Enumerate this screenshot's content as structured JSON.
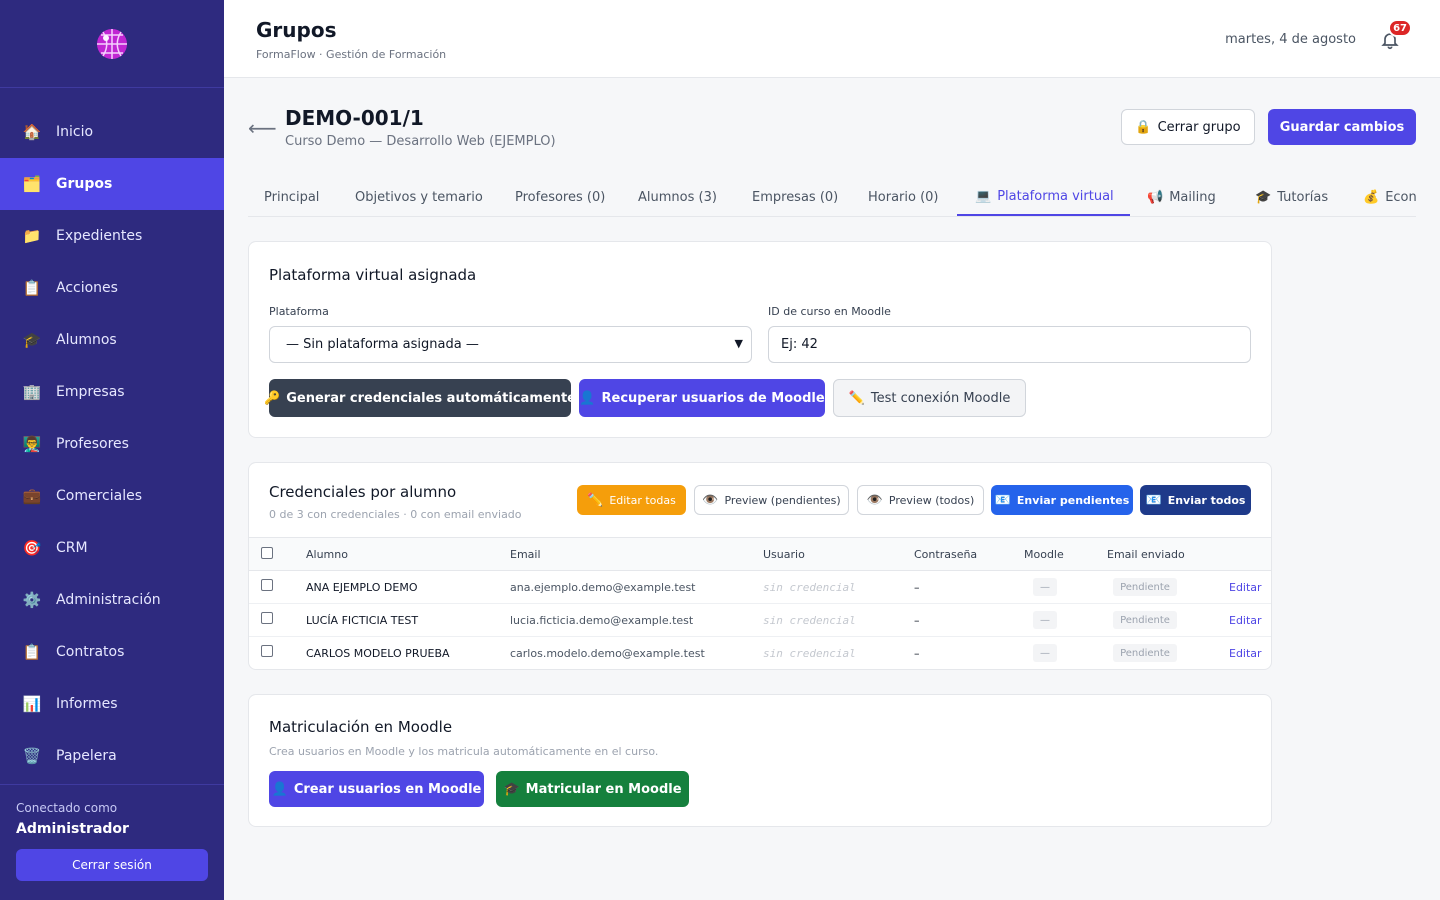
{
  "sidebar": {
    "items": [
      {
        "label": "Inicio",
        "icon": "🏠"
      },
      {
        "label": "Grupos",
        "icon": "🗂️"
      },
      {
        "label": "Expedientes",
        "icon": "📁"
      },
      {
        "label": "Acciones",
        "icon": "📋"
      },
      {
        "label": "Alumnos",
        "icon": "🎓"
      },
      {
        "label": "Empresas",
        "icon": "🏢"
      },
      {
        "label": "Profesores",
        "icon": "👨‍🏫"
      },
      {
        "label": "Comerciales",
        "icon": "💼"
      },
      {
        "label": "CRM",
        "icon": "🎯"
      },
      {
        "label": "Administración",
        "icon": "⚙️"
      },
      {
        "label": "Contratos",
        "icon": "📋"
      },
      {
        "label": "Informes",
        "icon": "📊"
      },
      {
        "label": "Papelera",
        "icon": "🗑️"
      }
    ],
    "connected_label": "Conectado como",
    "user": "Administrador",
    "logout": "Cerrar sesión"
  },
  "header": {
    "title": "Grupos",
    "breadcrumb": "FormaFlow · Gestión de Formación",
    "date": "martes, 4 de agosto",
    "notifications": "67"
  },
  "group": {
    "code": "DEMO-001/1",
    "course": "Curso Demo — Desarrollo Web (EJEMPLO)",
    "close_label": "Cerrar grupo",
    "close_icon": "🔒",
    "save_label": "Guardar cambios"
  },
  "tabs": [
    {
      "label": "Principal",
      "icon": ""
    },
    {
      "label": "Objetivos y temario",
      "icon": ""
    },
    {
      "label": "Profesores (0)",
      "icon": ""
    },
    {
      "label": "Alumnos (3)",
      "icon": ""
    },
    {
      "label": "Empresas (0)",
      "icon": ""
    },
    {
      "label": "Horario (0)",
      "icon": ""
    },
    {
      "label": "Plataforma virtual",
      "icon": "💻"
    },
    {
      "label": "Mailing",
      "icon": "📢"
    },
    {
      "label": "Tutorías",
      "icon": "🎓"
    },
    {
      "label": "Econ",
      "icon": "💰"
    }
  ],
  "platform": {
    "title": "Plataforma virtual asignada",
    "platform_label": "Plataforma",
    "platform_value": "— Sin plataforma asignada —",
    "moodle_id_label": "ID de curso en Moodle",
    "moodle_id_value": "Ej: 42",
    "btn_generate": "Generar credenciales automáticamente",
    "btn_generate_icon": "🔑",
    "btn_recover": "Recuperar usuarios de Moodle",
    "btn_recover_icon": "👤",
    "btn_test": "Test conexión Moodle",
    "btn_test_icon": "✏️"
  },
  "credentials": {
    "title": "Credenciales por alumno",
    "summary": "0 de 3 con credenciales · 0 con email enviado",
    "btn_edit_all": "Editar todas",
    "btn_edit_all_icon": "✏️",
    "btn_preview_pending": "Preview (pendientes)",
    "btn_preview_all": "Preview (todos)",
    "preview_icon": "👁️",
    "btn_send_pending": "Enviar pendientes",
    "btn_send_all": "Enviar todos",
    "send_icon": "📧",
    "columns": [
      "Alumno",
      "Email",
      "Usuario",
      "Contraseña",
      "Moodle",
      "Email enviado"
    ],
    "rows": [
      {
        "name": "ANA EJEMPLO DEMO",
        "email": "ana.ejemplo.demo@example.test",
        "user": "sin credencial",
        "password": "–",
        "moodle": "—",
        "status": "Pendiente",
        "action": "Editar"
      },
      {
        "name": "LUCÍA FICTICIA TEST",
        "email": "lucia.ficticia.demo@example.test",
        "user": "sin credencial",
        "password": "–",
        "moodle": "—",
        "status": "Pendiente",
        "action": "Editar"
      },
      {
        "name": "CARLOS MODELO PRUEBA",
        "email": "carlos.modelo.demo@example.test",
        "user": "sin credencial",
        "password": "–",
        "moodle": "—",
        "status": "Pendiente",
        "action": "Editar"
      }
    ]
  },
  "enrollment": {
    "title": "Matriculación en Moodle",
    "description": "Crea usuarios en Moodle y los matricula automáticamente en el curso.",
    "btn_create": "Crear usuarios en Moodle",
    "btn_create_icon": "👤",
    "btn_enroll": "Matricular en Moodle",
    "btn_enroll_icon": "🎓"
  }
}
